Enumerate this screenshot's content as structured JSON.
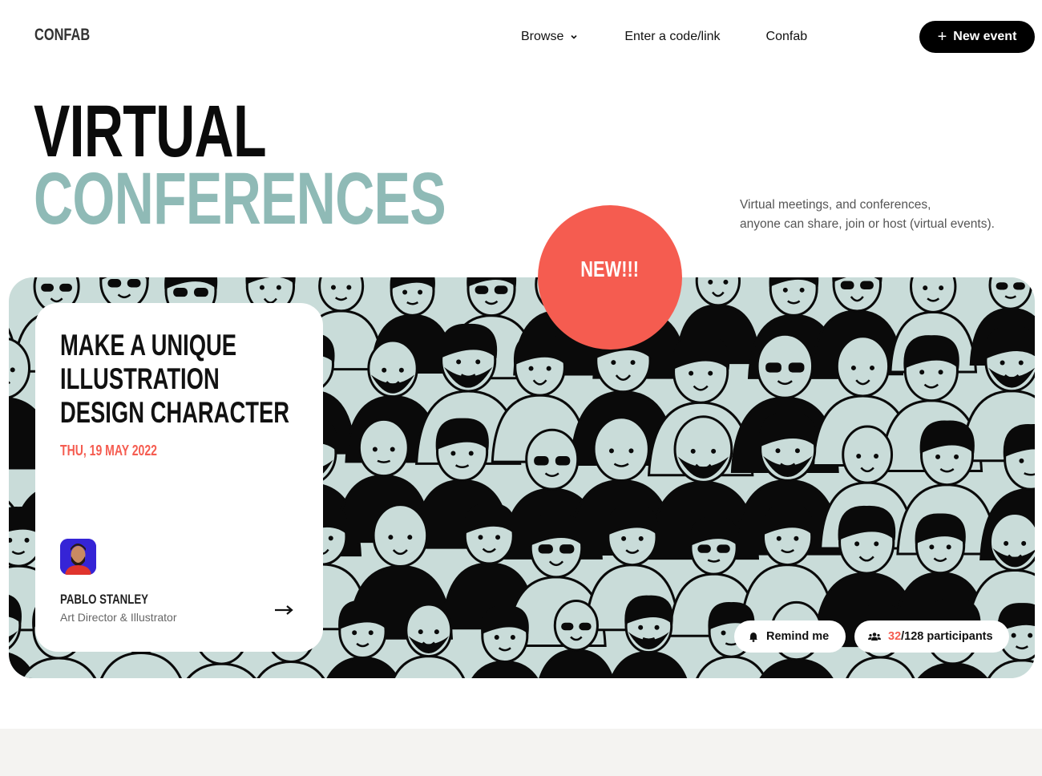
{
  "header": {
    "logo": "CONFAB",
    "nav": {
      "browse": "Browse",
      "enter_code": "Enter a code/link",
      "confab": "Confab"
    },
    "new_event_label": "New event"
  },
  "hero": {
    "title_line1": "VIRTUAL",
    "title_line2": "CONFERENCES",
    "tagline_line1": "Virtual meetings, and conferences,",
    "tagline_line2": "anyone can share, join or host (virtual events)."
  },
  "featured": {
    "badge": "NEW!!!",
    "title": "Make a unique illustration design character",
    "date": "THU, 19 MAY 2022",
    "speaker": {
      "name": "PABLO STANLEY",
      "role": "Art Director & Illustrator"
    },
    "remind_label": "Remind me",
    "participants_current": "32",
    "participants_rest": "/128 participants"
  },
  "colors": {
    "accent": "#f55c50",
    "teal": "#8fbab6",
    "banner_bg": "#c9dcd9",
    "dark": "#000000"
  },
  "icons": [
    "chevron-down-icon",
    "plus-icon",
    "arrow-right-icon",
    "bell-icon",
    "people-icon"
  ]
}
